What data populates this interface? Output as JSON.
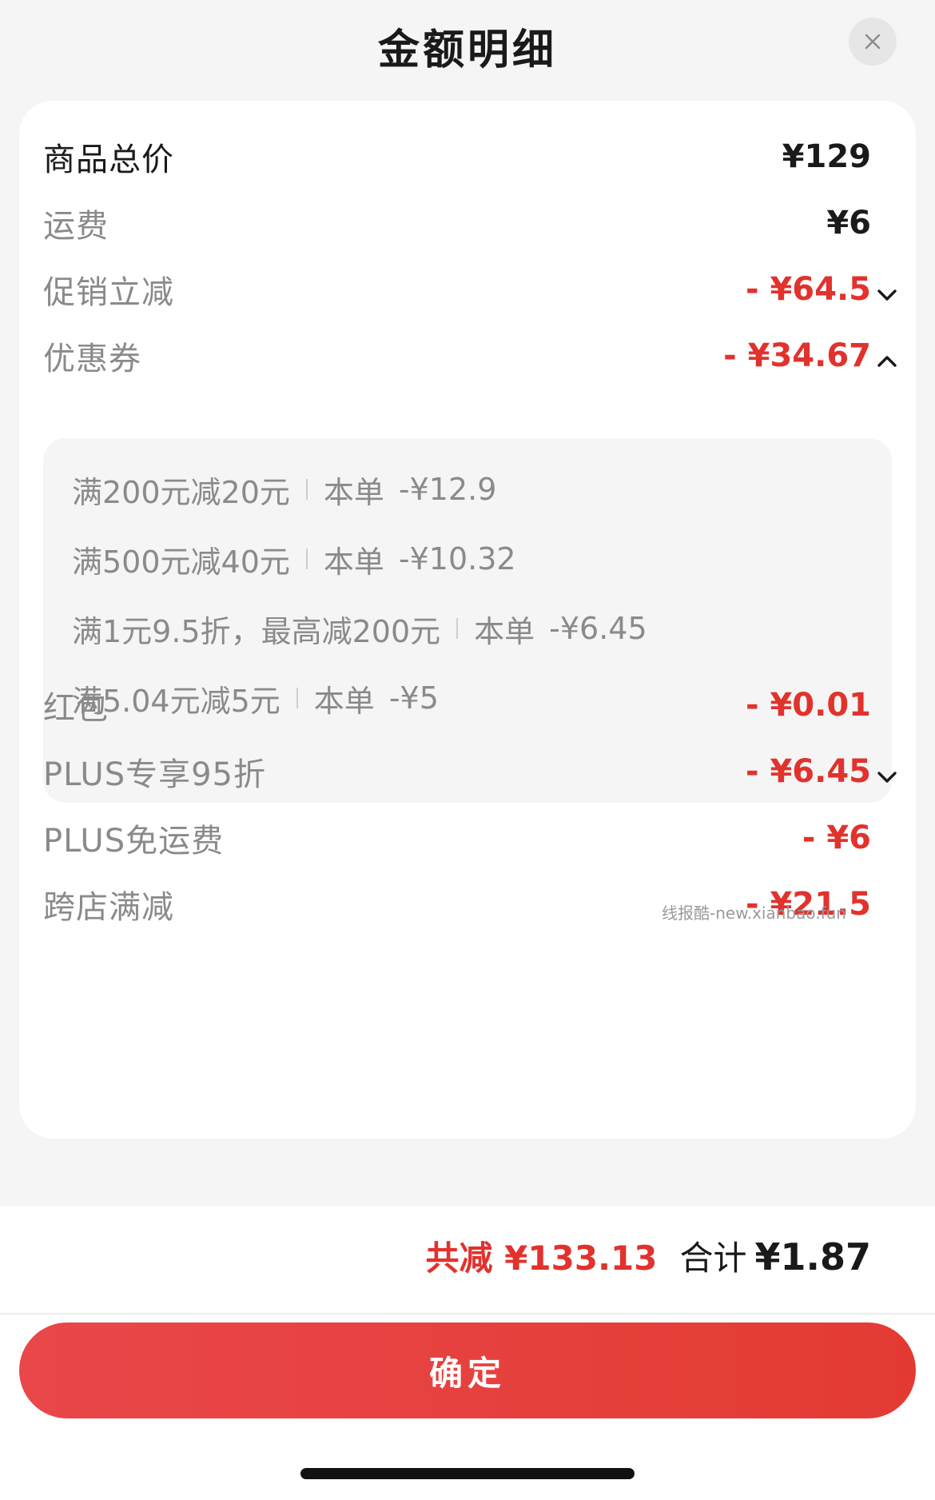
{
  "header": {
    "title": "金额明细",
    "close_icon": "close-icon"
  },
  "rows": {
    "goods_total": {
      "label": "商品总价",
      "value": "¥129"
    },
    "shipping": {
      "label": "运费",
      "value": "¥6"
    },
    "promo": {
      "label": "促销立减",
      "value": "- ¥64.5"
    },
    "coupon": {
      "label": "优惠券",
      "value": "- ¥34.67"
    },
    "red_packet": {
      "label": "红包",
      "value": "- ¥0.01"
    },
    "plus_discount": {
      "label": "PLUS专享95折",
      "value": "- ¥6.45"
    },
    "plus_shipping": {
      "label": "PLUS免运费",
      "value": "- ¥6"
    },
    "cross_store": {
      "label": "跨店满减",
      "value": "- ¥21.5"
    }
  },
  "coupons": [
    {
      "rule": "满200元减20元",
      "order_label": "本单",
      "amount": "-¥12.9"
    },
    {
      "rule": "满500元减40元",
      "order_label": "本单",
      "amount": "-¥10.32"
    },
    {
      "rule": "满1元9.5折，最高减200元",
      "order_label": "本单",
      "amount": "-¥6.45"
    },
    {
      "rule": "满5.04元减5元",
      "order_label": "本单",
      "amount": "-¥5"
    }
  ],
  "watermark": "线报酷-new.xianbao.fun",
  "summary": {
    "saved": "共减 ¥133.13",
    "total_label": "合计",
    "total_value": "¥1.87"
  },
  "confirm_label": "确定",
  "colors": {
    "accent_red": "#e1322d",
    "button_red": "#e9474a"
  }
}
